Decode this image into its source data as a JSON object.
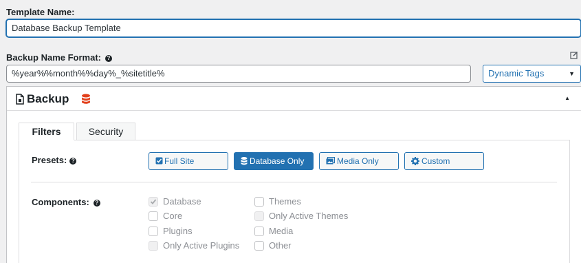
{
  "template": {
    "label": "Template Name:",
    "value": "Database Backup Template"
  },
  "name_format": {
    "label": "Backup Name Format:",
    "help": "?",
    "value": "%year%%month%%day%_%sitetitle%",
    "tags_select": "Dynamic Tags"
  },
  "panel": {
    "title": "Backup"
  },
  "tabs": [
    {
      "label": "Filters",
      "active": true
    },
    {
      "label": "Security",
      "active": false
    }
  ],
  "presets": {
    "label": "Presets:",
    "help": "?",
    "buttons": [
      {
        "label": "Full Site",
        "active": false
      },
      {
        "label": "Database Only",
        "active": true
      },
      {
        "label": "Media Only",
        "active": false
      },
      {
        "label": "Custom",
        "active": false
      }
    ]
  },
  "components": {
    "label": "Components:",
    "help": "?",
    "left": [
      {
        "label": "Database",
        "checked": true,
        "disabled": true
      },
      {
        "label": "Core",
        "checked": false,
        "disabled": false
      },
      {
        "label": "Plugins",
        "checked": false,
        "disabled": false
      },
      {
        "label": "Only Active Plugins",
        "checked": false,
        "disabled": true
      }
    ],
    "right": [
      {
        "label": "Themes",
        "checked": false,
        "disabled": false
      },
      {
        "label": "Only Active Themes",
        "checked": false,
        "disabled": true
      },
      {
        "label": "Media",
        "checked": false,
        "disabled": false
      },
      {
        "label": "Other",
        "checked": false,
        "disabled": false
      }
    ]
  },
  "colors": {
    "accent": "#2271b1",
    "db_icon": "#e2401c"
  }
}
